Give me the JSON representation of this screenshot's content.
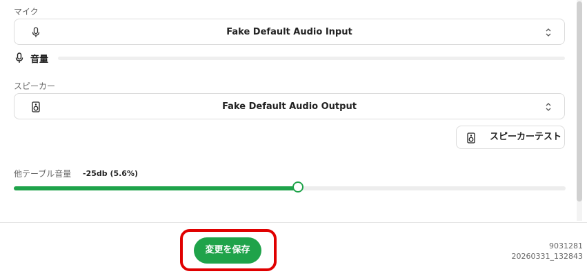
{
  "mic": {
    "label": "マイク",
    "device": "Fake Default Audio Input",
    "icon": "microphone-icon"
  },
  "input_meter": {
    "label": "音量",
    "icon": "microphone-icon",
    "level": 0
  },
  "speaker": {
    "label": "スピーカー",
    "device": "Fake Default Audio Output",
    "icon": "speaker-icon"
  },
  "speaker_test": {
    "label": "スピーカーテスト",
    "icon": "speaker-icon"
  },
  "other_volume": {
    "label": "他テーブル音量",
    "value_text": "-25db (5.6%)",
    "slider_fraction": 0.515,
    "accent": "#1fa34a"
  },
  "footer": {
    "save_label": "変更を保存",
    "build_number": "9031281",
    "build_timestamp": "20260331_132843",
    "highlight_color": "#e00000"
  }
}
